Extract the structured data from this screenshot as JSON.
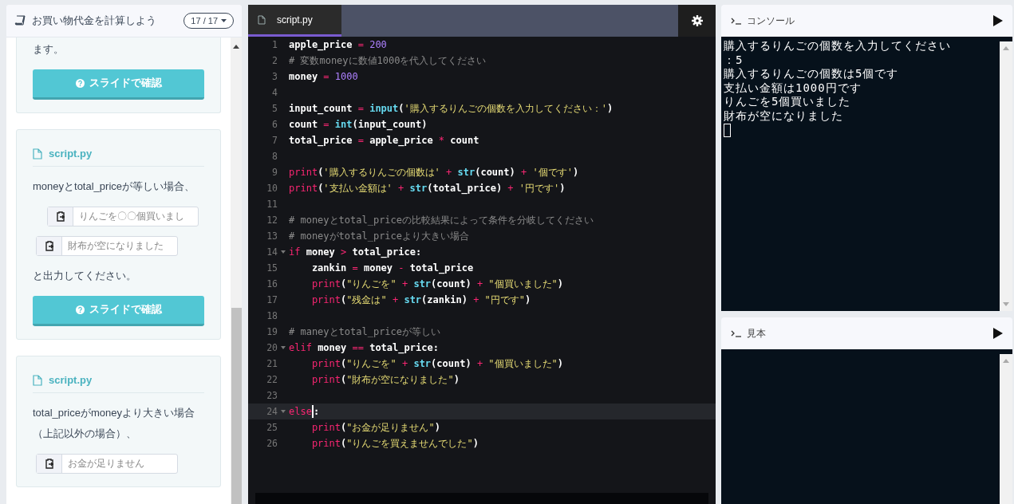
{
  "sidebar": {
    "title": "お買い物代金を計算しよう",
    "page_counter": "17 / 17",
    "cards": [
      {
        "blocks": [
          {
            "kind": "text",
            "text": "ます。"
          },
          {
            "kind": "button",
            "text": "スライドで確認"
          }
        ]
      },
      {
        "file": "script.py",
        "blocks": [
          {
            "kind": "text",
            "text": "moneyとtotal_priceが等しい場合、"
          },
          {
            "kind": "copy",
            "text": "りんごを〇〇個買いまし",
            "center": true
          },
          {
            "kind": "copy",
            "text": "財布が空になりました",
            "center": false
          },
          {
            "kind": "text",
            "text": "と出力してください。"
          },
          {
            "kind": "button",
            "text": "スライドで確認"
          }
        ]
      },
      {
        "file": "script.py",
        "blocks": [
          {
            "kind": "text",
            "text": "total_priceがmoneyより大きい場合（上記以外の場合）、"
          },
          {
            "kind": "copy",
            "text": "お金が足りません",
            "center": false
          }
        ]
      }
    ]
  },
  "editor": {
    "tab": {
      "label": "script.py",
      "selected": true
    },
    "lines": [
      {
        "number": "1",
        "tokens": [
          {
            "kind": "plain",
            "text": "apple_price "
          },
          {
            "kind": "op",
            "text": "="
          },
          {
            "kind": "num",
            "text": " 200"
          }
        ]
      },
      {
        "number": "2",
        "tokens": [
          {
            "kind": "cmt",
            "text": "# 変数moneyに数値1000を代入してください"
          }
        ]
      },
      {
        "number": "3",
        "tokens": [
          {
            "kind": "plain",
            "text": "money "
          },
          {
            "kind": "op",
            "text": "="
          },
          {
            "kind": "num",
            "text": " 1000"
          }
        ]
      },
      {
        "number": "4"
      },
      {
        "number": "5",
        "tokens": [
          {
            "kind": "plain",
            "text": "input_count "
          },
          {
            "kind": "op",
            "text": "="
          },
          {
            "kind": "fn",
            "text": " input"
          },
          {
            "kind": "plain",
            "text": "("
          },
          {
            "kind": "str",
            "text": "'購入するりんごの個数を入力してください：'"
          },
          {
            "kind": "plain",
            "text": ")"
          }
        ]
      },
      {
        "number": "6",
        "tokens": [
          {
            "kind": "plain",
            "text": "count "
          },
          {
            "kind": "op",
            "text": "="
          },
          {
            "kind": "fn",
            "text": " int"
          },
          {
            "kind": "plain",
            "text": "(input_count)"
          }
        ]
      },
      {
        "number": "7",
        "tokens": [
          {
            "kind": "plain",
            "text": "total_price "
          },
          {
            "kind": "op",
            "text": "="
          },
          {
            "kind": "plain",
            "text": " apple_price "
          },
          {
            "kind": "op",
            "text": "*"
          },
          {
            "kind": "plain",
            "text": " count"
          }
        ]
      },
      {
        "number": "8"
      },
      {
        "number": "9",
        "tokens": [
          {
            "kind": "kw",
            "text": "print"
          },
          {
            "kind": "plain",
            "text": "("
          },
          {
            "kind": "str",
            "text": "'購入するりんごの個数は'"
          },
          {
            "kind": "op",
            "text": " + "
          },
          {
            "kind": "fn",
            "text": "str"
          },
          {
            "kind": "plain",
            "text": "(count) "
          },
          {
            "kind": "op",
            "text": "+"
          },
          {
            "kind": "str",
            "text": " '個です'"
          },
          {
            "kind": "plain",
            "text": ")"
          }
        ]
      },
      {
        "number": "10",
        "tokens": [
          {
            "kind": "kw",
            "text": "print"
          },
          {
            "kind": "plain",
            "text": "("
          },
          {
            "kind": "str",
            "text": "'支払い金額は'"
          },
          {
            "kind": "op",
            "text": " + "
          },
          {
            "kind": "fn",
            "text": "str"
          },
          {
            "kind": "plain",
            "text": "(total_price) "
          },
          {
            "kind": "op",
            "text": "+"
          },
          {
            "kind": "str",
            "text": " '円です'"
          },
          {
            "kind": "plain",
            "text": ")"
          }
        ]
      },
      {
        "number": "11"
      },
      {
        "number": "12",
        "tokens": [
          {
            "kind": "cmt",
            "text": "# moneyとtotal_priceの比較結果によって条件を分岐してください"
          }
        ]
      },
      {
        "number": "13",
        "tokens": [
          {
            "kind": "cmt",
            "text": "# moneyがtotal_priceより大きい場合"
          }
        ]
      },
      {
        "number": "14",
        "fold": true,
        "tokens": [
          {
            "kind": "kw",
            "text": "if"
          },
          {
            "kind": "plain",
            "text": " money "
          },
          {
            "kind": "op",
            "text": ">"
          },
          {
            "kind": "plain",
            "text": " total_price:"
          }
        ]
      },
      {
        "number": "15",
        "tokens": [
          {
            "kind": "plain",
            "text": "    zankin "
          },
          {
            "kind": "op",
            "text": "="
          },
          {
            "kind": "plain",
            "text": " money "
          },
          {
            "kind": "op",
            "text": "-"
          },
          {
            "kind": "plain",
            "text": " total_price"
          }
        ]
      },
      {
        "number": "16",
        "tokens": [
          {
            "kind": "kw",
            "text": "    print"
          },
          {
            "kind": "plain",
            "text": "("
          },
          {
            "kind": "str",
            "text": "\"りんごを\""
          },
          {
            "kind": "op",
            "text": " + "
          },
          {
            "kind": "fn",
            "text": "str"
          },
          {
            "kind": "plain",
            "text": "(count) "
          },
          {
            "kind": "op",
            "text": "+"
          },
          {
            "kind": "str",
            "text": " \"個買いました\""
          },
          {
            "kind": "plain",
            "text": ")"
          }
        ]
      },
      {
        "number": "17",
        "tokens": [
          {
            "kind": "kw",
            "text": "    print"
          },
          {
            "kind": "plain",
            "text": "("
          },
          {
            "kind": "str",
            "text": "\"残金は\""
          },
          {
            "kind": "op",
            "text": " + "
          },
          {
            "kind": "fn",
            "text": "str"
          },
          {
            "kind": "plain",
            "text": "(zankin) "
          },
          {
            "kind": "op",
            "text": "+"
          },
          {
            "kind": "str",
            "text": " \"円です\""
          },
          {
            "kind": "plain",
            "text": ")"
          }
        ]
      },
      {
        "number": "18"
      },
      {
        "number": "19",
        "tokens": [
          {
            "kind": "cmt",
            "text": "# maneyとtotal_priceが等しい"
          }
        ]
      },
      {
        "number": "20",
        "fold": true,
        "tokens": [
          {
            "kind": "kw",
            "text": "elif"
          },
          {
            "kind": "plain",
            "text": " money "
          },
          {
            "kind": "op",
            "text": "=="
          },
          {
            "kind": "plain",
            "text": " total_price:"
          }
        ]
      },
      {
        "number": "21",
        "tokens": [
          {
            "kind": "kw",
            "text": "    print"
          },
          {
            "kind": "plain",
            "text": "("
          },
          {
            "kind": "str",
            "text": "\"りんごを\""
          },
          {
            "kind": "op",
            "text": " + "
          },
          {
            "kind": "fn",
            "text": "str"
          },
          {
            "kind": "plain",
            "text": "(count) "
          },
          {
            "kind": "op",
            "text": "+"
          },
          {
            "kind": "str",
            "text": " \"個買いました\""
          },
          {
            "kind": "plain",
            "text": ")"
          }
        ]
      },
      {
        "number": "22",
        "tokens": [
          {
            "kind": "kw",
            "text": "    print"
          },
          {
            "kind": "plain",
            "text": "("
          },
          {
            "kind": "str",
            "text": "\"財布が空になりました\""
          },
          {
            "kind": "plain",
            "text": ")"
          }
        ]
      },
      {
        "number": "23"
      },
      {
        "number": "24",
        "fold": true,
        "current": true,
        "tokens": [
          {
            "kind": "kw",
            "text": "else",
            "cursor": true
          },
          {
            "kind": "plain",
            "text": ":"
          }
        ]
      },
      {
        "number": "25",
        "tokens": [
          {
            "kind": "kw",
            "text": "    print"
          },
          {
            "kind": "plain",
            "text": "("
          },
          {
            "kind": "str",
            "text": "\"お金が足りません\""
          },
          {
            "kind": "plain",
            "text": ")"
          }
        ]
      },
      {
        "number": "26",
        "tokens": [
          {
            "kind": "kw",
            "text": "    print"
          },
          {
            "kind": "plain",
            "text": "("
          },
          {
            "kind": "str",
            "text": "\"りんごを買えませんでした\""
          },
          {
            "kind": "plain",
            "text": ")"
          }
        ]
      }
    ]
  },
  "console": {
    "title": "コンソール",
    "lines": [
      "購入するりんごの個数を入力してください",
      "：5",
      "購入するりんごの個数は5個です",
      "支払い金額は1000円です",
      "りんごを5個買いました",
      "財布が空になりました"
    ],
    "cursor": true
  },
  "sample": {
    "title": "見本"
  }
}
